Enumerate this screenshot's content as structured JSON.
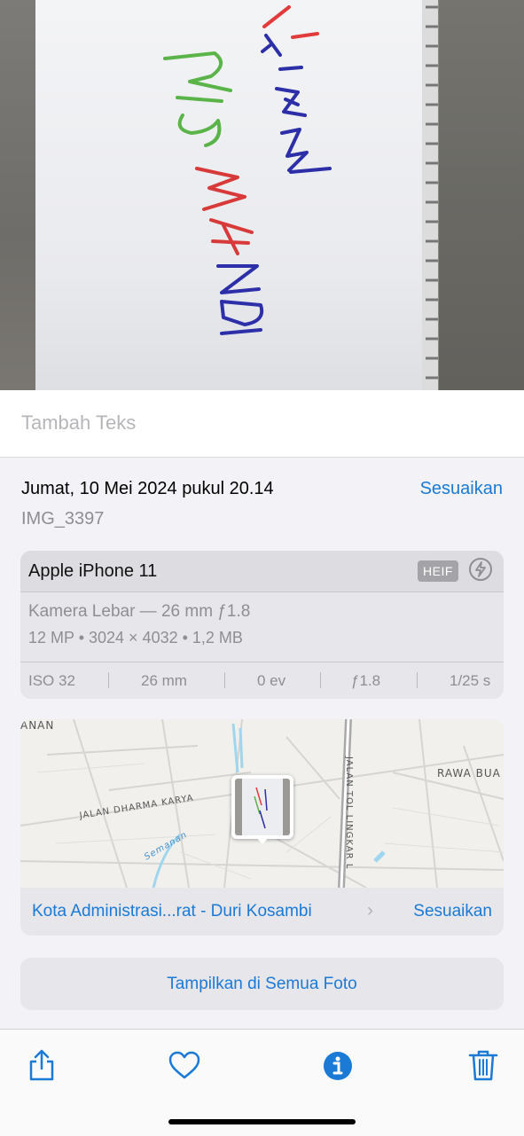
{
  "caption": {
    "placeholder": "Tambah Teks"
  },
  "info": {
    "date": "Jumat, 10 Mei 2024 pukul 20.14",
    "adjust_label": "Sesuaikan",
    "filename": "IMG_3397"
  },
  "camera": {
    "model": "Apple iPhone 11",
    "format_badge": "HEIF",
    "flash_icon": "flash-icon",
    "lens": "Kamera Lebar — 26 mm ƒ1.8",
    "specs": "12 MP  •  3024 × 4032  •  1,2 MB",
    "exif": [
      "ISO 32",
      "26 mm",
      "0 ev",
      "ƒ1.8",
      "1/25 s"
    ]
  },
  "map": {
    "labels": [
      "ANAN",
      "RAWA BUA",
      "JALAN DHARMA KARYA",
      "JALAN TOL LINGKAR L",
      "Semanan"
    ],
    "location": "Kota Administrasi...rat - Duri Kosambi",
    "adjust_label": "Sesuaikan"
  },
  "show_all": "Tampilkan di Semua Foto",
  "photo_text": {
    "line1": "FIAN",
    "line2": "RIS WANDI",
    "thumb": "ALFIAN RISWANDI"
  },
  "toolbar": {
    "share": "share-icon",
    "favorite": "heart-icon",
    "info": "info-icon",
    "delete": "trash-icon"
  },
  "colors": {
    "accent": "#1a7ad6",
    "secondary_text": "#8e8e93",
    "sheet_bg": "#f2f2f7"
  }
}
